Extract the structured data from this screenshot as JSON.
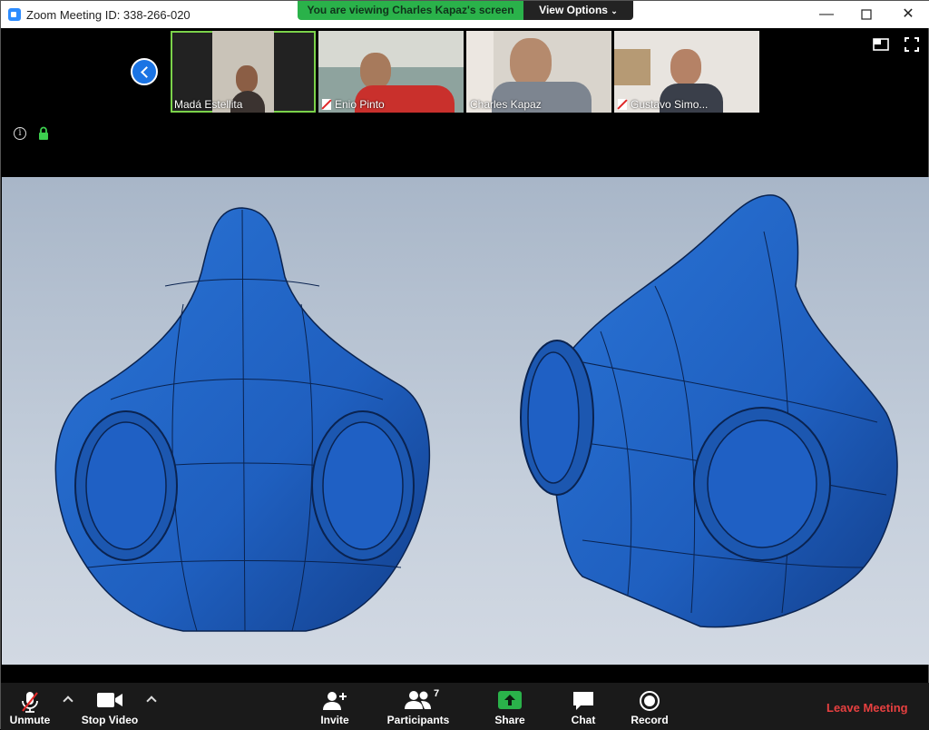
{
  "window": {
    "title": "Zoom Meeting ID: 338-266-020",
    "banner_text": "You are viewing Charles Kapaz's screen",
    "view_options_label": "View Options"
  },
  "participants_strip": [
    {
      "name": "Madá Estellita",
      "muted": false,
      "active": true
    },
    {
      "name": "Enio Pinto",
      "muted": true,
      "active": false
    },
    {
      "name": "Charles Kapaz",
      "muted": false,
      "active": false
    },
    {
      "name": "Gustavo Simo...",
      "muted": true,
      "active": false
    }
  ],
  "toolbar": {
    "unmute_label": "Unmute",
    "stop_video_label": "Stop Video",
    "invite_label": "Invite",
    "participants_label": "Participants",
    "participants_count": "7",
    "share_label": "Share",
    "chat_label": "Chat",
    "record_label": "Record",
    "leave_label": "Leave Meeting"
  },
  "colors": {
    "share_banner": "#2ab24a",
    "leave_text": "#e74040",
    "model_blue": "#1f5fbf",
    "nav_blue": "#1b74e4"
  }
}
